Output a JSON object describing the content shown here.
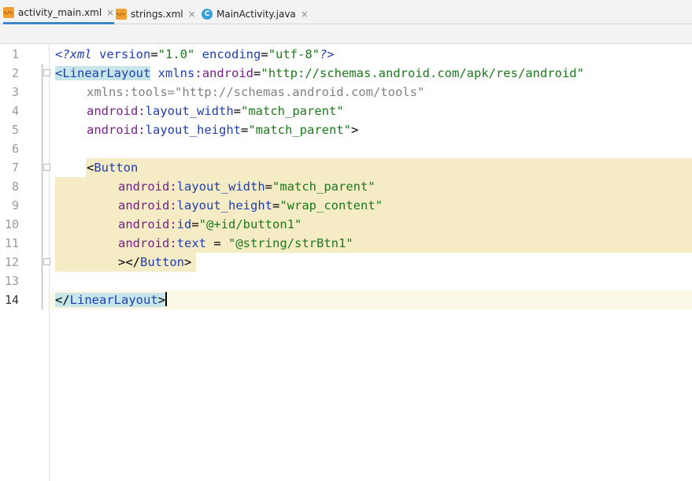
{
  "tabs": [
    {
      "label": "activity_main.xml",
      "icon": "xml-file-icon",
      "active": true
    },
    {
      "label": "strings.xml",
      "icon": "xml-file-icon",
      "active": false
    },
    {
      "label": "MainActivity.java",
      "icon": "java-class-icon",
      "active": false
    }
  ],
  "close_glyph": "×",
  "line_numbers": [
    "1",
    "2",
    "3",
    "4",
    "5",
    "6",
    "7",
    "8",
    "9",
    "10",
    "11",
    "12",
    "13",
    "14"
  ],
  "code": {
    "l1": {
      "open": "<",
      "pi": "?xml",
      "a1": " version",
      "eq1": "=",
      "s1": "\"1.0\"",
      "a2": " encoding",
      "eq2": "=",
      "s2": "\"utf-8\"",
      "close": "?>"
    },
    "l2": {
      "open": "<",
      "tag": "LinearLayout",
      "sp": " ",
      "ns1": "xmlns",
      "colon": ":",
      "ns2": "android",
      "eq": "=",
      "str": "\"http://schemas.android.com/apk/res/android\""
    },
    "l3": {
      "attr": "xmlns:tools",
      "eq": "=",
      "str": "\"http://schemas.android.com/tools\""
    },
    "l4": {
      "ns": "android",
      "colon": ":",
      "attr": "layout_width",
      "eq": "=",
      "str": "\"match_parent\""
    },
    "l5": {
      "ns": "android",
      "colon": ":",
      "attr": "layout_height",
      "eq": "=",
      "str": "\"match_parent\"",
      "close": ">"
    },
    "l7": {
      "open": "<",
      "tag": "Button"
    },
    "l8": {
      "ns": "android",
      "colon": ":",
      "attr": "layout_width",
      "eq": "=",
      "str": "\"match_parent\""
    },
    "l9": {
      "ns": "android",
      "colon": ":",
      "attr": "layout_height",
      "eq": "=",
      "str": "\"wrap_content\""
    },
    "l10": {
      "ns": "android",
      "colon": ":",
      "attr": "id",
      "eq": "=",
      "str": "\"@+id/button1\""
    },
    "l11": {
      "ns": "android",
      "colon": ":",
      "attr": "text",
      "eq": " = ",
      "str": "\"@string/strBtn1\""
    },
    "l12": {
      "punct": "></",
      "tag": "Button",
      "close": ">"
    },
    "l14": {
      "open": "</",
      "tag": "LinearLayout",
      "close": ">"
    }
  },
  "colors": {
    "tag": "#1f3fb4",
    "namespace": "#7a1f8c",
    "string": "#1c7a1c",
    "block_highlight": "#f5ebc5",
    "tag_match": "#c6e6ea",
    "active_tab_underline": "#4083c9"
  }
}
